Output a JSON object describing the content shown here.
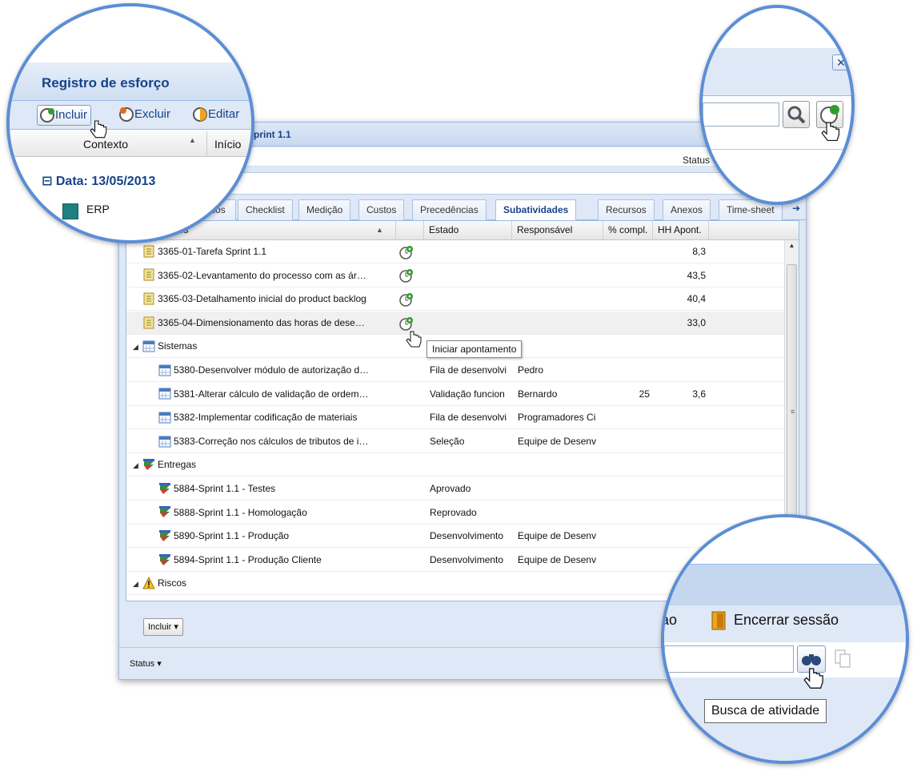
{
  "window": {
    "title": "Sprint 1.1",
    "status_label": "Status"
  },
  "tabs": [
    {
      "label": "Dados"
    },
    {
      "label": "Checklist"
    },
    {
      "label": "Medição"
    },
    {
      "label": "Custos"
    },
    {
      "label": "Precedências"
    },
    {
      "label": "Subatividades"
    },
    {
      "label": "Recursos"
    },
    {
      "label": "Anexos"
    },
    {
      "label": "Time-sheet"
    }
  ],
  "grid": {
    "columns": [
      "Atividades",
      "Estado",
      "Responsável",
      "% compl.",
      "HH Apont."
    ],
    "header_partial": "vidades",
    "rows": [
      {
        "level": 1,
        "icon": "task-icon",
        "name": "3365-01-Tarefa Sprint 1.1",
        "estado": "",
        "resp": "",
        "compl": "",
        "hh": "8,3",
        "clock": true
      },
      {
        "level": 1,
        "icon": "task-icon",
        "name": "3365-02-Levantamento do processo com as ár…",
        "estado": "",
        "resp": "",
        "compl": "",
        "hh": "43,5",
        "clock": true
      },
      {
        "level": 1,
        "icon": "task-icon",
        "name": "3365-03-Detalhamento inicial do product backlog",
        "estado": "",
        "resp": "",
        "compl": "",
        "hh": "40,4",
        "clock": true
      },
      {
        "level": 1,
        "icon": "task-icon",
        "name": "3365-04-Dimensionamento das horas de dese…",
        "estado": "",
        "resp": "",
        "compl": "",
        "hh": "33,0",
        "clock": true,
        "hl": true
      },
      {
        "level": 0,
        "icon": "calendar-icon",
        "name": "Sistemas",
        "group": true
      },
      {
        "level": 2,
        "icon": "calendar-icon",
        "name": "5380-Desenvolver módulo de autorização d…",
        "estado": "Fila de desenvolvi",
        "resp": "Pedro",
        "compl": "",
        "hh": ""
      },
      {
        "level": 2,
        "icon": "calendar-icon",
        "name": "5381-Alterar cálculo de validação de ordem…",
        "estado": "Validação funcion",
        "resp": "Bernardo",
        "compl": "25",
        "hh": "3,6"
      },
      {
        "level": 2,
        "icon": "calendar-icon",
        "name": "5382-Implementar codificação de materiais",
        "estado": "Fila de desenvolvi",
        "resp": "Programadores Ci",
        "compl": "",
        "hh": ""
      },
      {
        "level": 2,
        "icon": "calendar-icon",
        "name": "5383-Correção nos cálculos de tributos de i…",
        "estado": "Seleção",
        "resp": "Equipe de Desenv",
        "compl": "",
        "hh": ""
      },
      {
        "level": 0,
        "icon": "delivery-icon",
        "name": "Entregas",
        "group": true
      },
      {
        "level": 2,
        "icon": "delivery-icon",
        "name": "5884-Sprint 1.1 - Testes",
        "estado": "Aprovado",
        "resp": "",
        "compl": "",
        "hh": ""
      },
      {
        "level": 2,
        "icon": "delivery-icon",
        "name": "5888-Sprint 1.1 - Homologação",
        "estado": "Reprovado",
        "resp": "",
        "compl": "",
        "hh": ""
      },
      {
        "level": 2,
        "icon": "delivery-icon",
        "name": "5890-Sprint 1.1 - Produção",
        "estado": "Desenvolvimento",
        "resp": "Equipe de Desenv",
        "compl": "",
        "hh": ""
      },
      {
        "level": 2,
        "icon": "delivery-icon",
        "name": "5894-Sprint 1.1 - Produção Cliente",
        "estado": "Desenvolvimento",
        "resp": "Equipe de Desenv",
        "compl": "",
        "hh": ""
      },
      {
        "level": 0,
        "icon": "warning-icon",
        "name": "Riscos",
        "group": true
      }
    ]
  },
  "tooltip": "Iniciar apontamento",
  "bottom": {
    "incluir": "Incluir",
    "status": "Status"
  },
  "zoom1": {
    "title": "Registro de esforço",
    "btn_incluir": "Incluir",
    "btn_excluir": "Excluir",
    "btn_editar": "Editar",
    "col_contexto": "Contexto",
    "col_inicio": "Início",
    "group": "Data: 13/05/2013",
    "item": "ERP"
  },
  "zoom3": {
    "encerrar": "Encerrar sessão",
    "partial": "ao",
    "tooltip": "Busca de atividade"
  }
}
